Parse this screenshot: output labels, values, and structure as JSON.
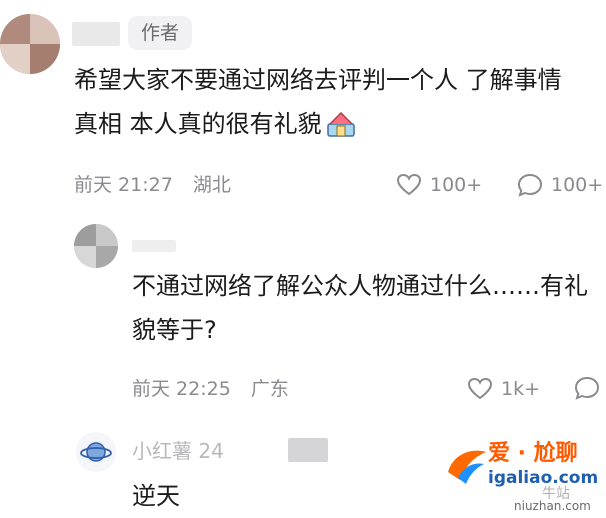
{
  "colors": {
    "text": "#1b1b1b",
    "meta": "#8a8a8f",
    "badge_bg": "#f1f1f3",
    "watermark": "#ff5a00"
  },
  "comment1": {
    "badge": "作者",
    "text_line1": "希望大家不要通过网络去评判一个人 了解事情",
    "text_line2": "真相 本人真的很有礼貌",
    "time": "前天 21:27",
    "location": "湖北",
    "likes": "100+",
    "replies": "100+"
  },
  "comment2": {
    "text_line1": "不通过网络了解公众人物通过什么……有礼",
    "text_line2": "貌等于?",
    "time": "前天 22:25",
    "location": "广东",
    "likes": "1k+"
  },
  "comment3": {
    "username": "小红薯 24",
    "text": "逆天"
  },
  "watermark": {
    "title": "爱 · 尬聊",
    "url": "igaliao.com",
    "sub": "牛站",
    "url2": "niuzhan.com"
  },
  "icons": {
    "emoji": "house-emoji-icon",
    "heart": "heart-icon",
    "comment": "comment-icon",
    "planet": "planet-icon"
  }
}
